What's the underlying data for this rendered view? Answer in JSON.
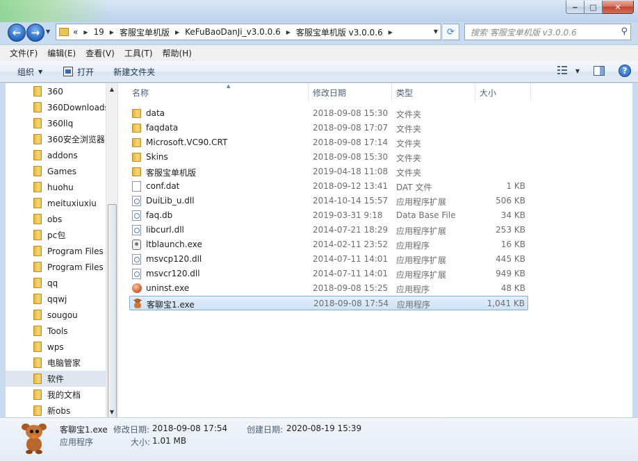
{
  "window": {
    "caption_min": "‒",
    "caption_max": "□",
    "caption_close": "✕"
  },
  "address": {
    "breadcrumbs": [
      "«",
      "19",
      "客服宝单机版",
      "KeFuBaoDanJi_v3.0.0.6",
      "客服宝单机版 v3.0.0.6"
    ],
    "search_placeholder": "搜索 客服宝单机版 v3.0.0.6"
  },
  "menu": [
    "文件(F)",
    "编辑(E)",
    "查看(V)",
    "工具(T)",
    "帮助(H)"
  ],
  "toolbar": {
    "organize": "组织",
    "open": "打开",
    "new_folder": "新建文件夹"
  },
  "nav_items": [
    "360",
    "360Downloads",
    "360llq",
    "360安全浏览器",
    "addons",
    "Games",
    "huohu",
    "meituxiuxiu",
    "obs",
    "pc包",
    "Program Files",
    "Program Files",
    "qq",
    "qqwj",
    "sougou",
    "Tools",
    "wps",
    "电脑管家",
    "软件",
    "我的文档",
    "新obs"
  ],
  "nav_selected_index": 18,
  "columns": {
    "name": "名称",
    "date": "修改日期",
    "type": "类型",
    "size": "大小"
  },
  "files": [
    {
      "name": "data",
      "date": "2018-09-08 15:30",
      "type": "文件夹",
      "size": "",
      "icon": "folder-icon"
    },
    {
      "name": "faqdata",
      "date": "2018-09-08 17:07",
      "type": "文件夹",
      "size": "",
      "icon": "folder-icon"
    },
    {
      "name": "Microsoft.VC90.CRT",
      "date": "2018-09-08 17:14",
      "type": "文件夹",
      "size": "",
      "icon": "folder-icon"
    },
    {
      "name": "Skins",
      "date": "2018-09-08 15:30",
      "type": "文件夹",
      "size": "",
      "icon": "folder-icon"
    },
    {
      "name": "客服宝单机版",
      "date": "2019-04-18 11:08",
      "type": "文件夹",
      "size": "",
      "icon": "folder-icon"
    },
    {
      "name": "conf.dat",
      "date": "2018-09-12 13:41",
      "type": "DAT 文件",
      "size": "1 KB",
      "icon": "document-icon"
    },
    {
      "name": "DuiLib_u.dll",
      "date": "2014-10-14 15:57",
      "type": "应用程序扩展",
      "size": "506 KB",
      "icon": "dll-icon"
    },
    {
      "name": "faq.db",
      "date": "2019-03-31 9:18",
      "type": "Data Base File",
      "size": "34 KB",
      "icon": "dll-icon"
    },
    {
      "name": "libcurl.dll",
      "date": "2014-07-21 18:29",
      "type": "应用程序扩展",
      "size": "253 KB",
      "icon": "dll-icon"
    },
    {
      "name": "ltblaunch.exe",
      "date": "2014-02-11 23:52",
      "type": "应用程序",
      "size": "16 KB",
      "icon": "exe-icon"
    },
    {
      "name": "msvcp120.dll",
      "date": "2014-07-11 14:01",
      "type": "应用程序扩展",
      "size": "445 KB",
      "icon": "dll-icon"
    },
    {
      "name": "msvcr120.dll",
      "date": "2014-07-11 14:01",
      "type": "应用程序扩展",
      "size": "949 KB",
      "icon": "dll-icon"
    },
    {
      "name": "uninst.exe",
      "date": "2018-09-08 15:25",
      "type": "应用程序",
      "size": "48 KB",
      "icon": "uninstall-icon"
    },
    {
      "name": "客聊宝1.exe",
      "date": "2018-09-08 17:54",
      "type": "应用程序",
      "size": "1,041 KB",
      "icon": "kaoliao-app-icon",
      "selected": true
    }
  ],
  "details": {
    "name": "客聊宝1.exe",
    "type": "应用程序",
    "modified_label": "修改日期:",
    "modified": "2018-09-08 17:54",
    "created_label": "创建日期:",
    "created": "2020-08-19 15:39",
    "size_label": "大小:",
    "size": "1.01 MB"
  }
}
